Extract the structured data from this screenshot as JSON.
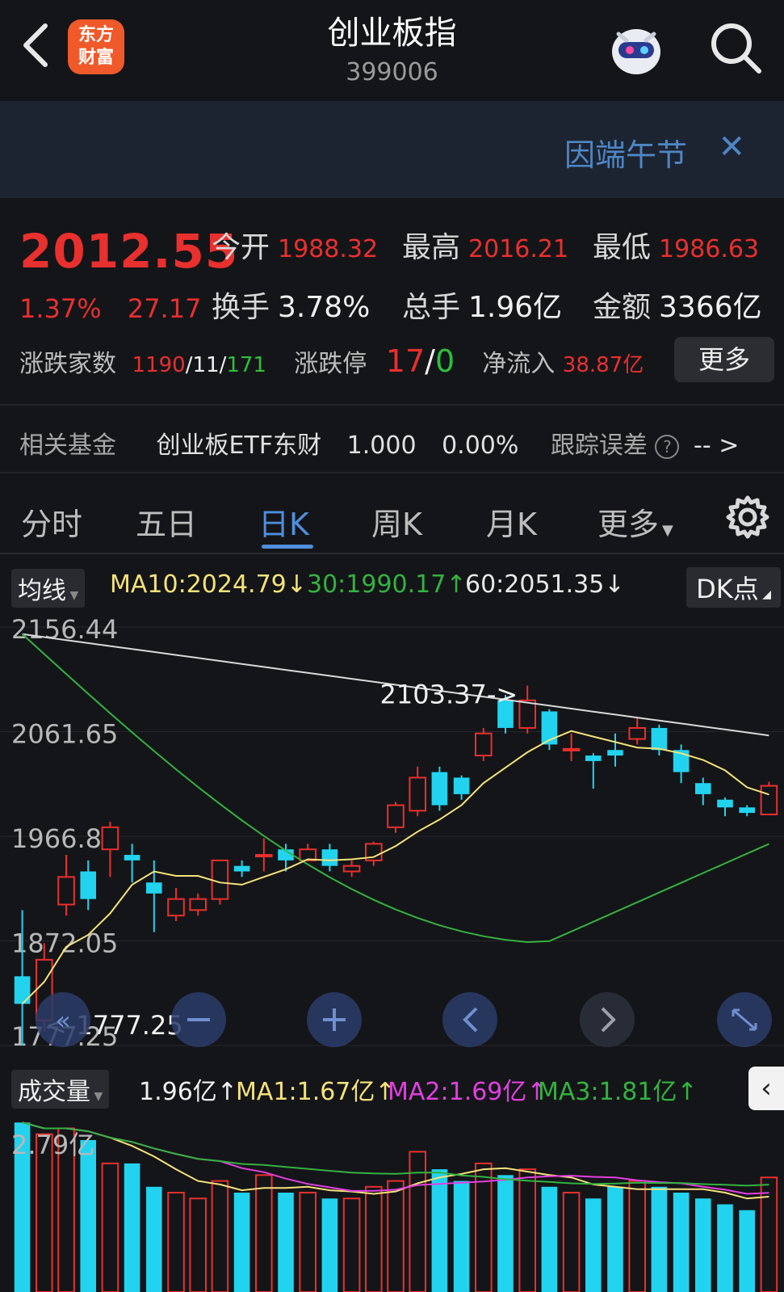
{
  "header": {
    "title": "创业板指",
    "code": "399006",
    "logo_text_line1": "东方",
    "logo_text_line2": "财富"
  },
  "banner": {
    "text": "因端午节"
  },
  "quote": {
    "price": "2012.55",
    "change_pct": "1.37%",
    "change_abs": "27.17",
    "open_label": "今开",
    "open": "1988.32",
    "high_label": "最高",
    "high": "2016.21",
    "low_label": "最低",
    "low": "1986.63",
    "turnover_label": "换手",
    "turnover": "3.78%",
    "volume_label": "总手",
    "volume": "1.96亿",
    "amount_label": "金额",
    "amount": "3366亿",
    "breadth_label": "涨跌家数",
    "up_count": "1190",
    "flat_count": "11",
    "down_count": "171",
    "limit_label": "涨跌停",
    "limit_up": "17",
    "limit_down": "0",
    "netflow_label": "净流入",
    "netflow": "38.87亿",
    "more_label": "更多"
  },
  "fund": {
    "label": "相关基金",
    "name": "创业板ETF东财",
    "nav": "1.000",
    "pct": "0.00%",
    "tracking_label": "跟踪误差",
    "tracking_value": "-- >"
  },
  "tabs": [
    {
      "label": "分时"
    },
    {
      "label": "五日"
    },
    {
      "label": "日K"
    },
    {
      "label": "周K"
    },
    {
      "label": "月K"
    },
    {
      "label": "更多"
    }
  ],
  "ma_legend": {
    "selector": "均线",
    "ma10": "MA10:2024.79↓",
    "ma30": "30:1990.17↑",
    "ma60": "60:2051.35↓",
    "dk": "DK点"
  },
  "vol_legend": {
    "selector": "成交量",
    "vol": "1.96亿↑",
    "ma1": "MA1:1.67亿↑",
    "ma2": "MA2:1.69亿↑",
    "ma3": "MA3:1.81亿↑"
  },
  "colors": {
    "up": "#e8302e",
    "down": "#22d3f0",
    "ma10": "#f5e27a",
    "ma30": "#33b240",
    "ma60": "#d8d8d8",
    "accent": "#4f8fdd"
  },
  "chart_data": {
    "type": "candlestick",
    "y_ticks": [
      "2156.44",
      "2061.65",
      "1966.85",
      "1872.05",
      "1777.25"
    ],
    "ylim": [
      1777.25,
      2156.44
    ],
    "annotations": {
      "high_marker": "2103.37",
      "low_marker": "1777.25"
    },
    "candles": [
      {
        "o": 1840,
        "c": 1815,
        "h": 1900,
        "l": 1777.25
      },
      {
        "o": 1800,
        "c": 1855,
        "h": 1870,
        "l": 1790
      },
      {
        "o": 1905,
        "c": 1930,
        "h": 1950,
        "l": 1895
      },
      {
        "o": 1935,
        "c": 1910,
        "h": 1945,
        "l": 1900
      },
      {
        "o": 1955,
        "c": 1975,
        "h": 1980,
        "l": 1930
      },
      {
        "o": 1950,
        "c": 1945,
        "h": 1960,
        "l": 1925
      },
      {
        "o": 1925,
        "c": 1915,
        "h": 1945,
        "l": 1880
      },
      {
        "o": 1895,
        "c": 1910,
        "h": 1920,
        "l": 1890
      },
      {
        "o": 1900,
        "c": 1910,
        "h": 1915,
        "l": 1895
      },
      {
        "o": 1910,
        "c": 1945,
        "h": 1945,
        "l": 1905
      },
      {
        "o": 1940,
        "c": 1935,
        "h": 1945,
        "l": 1930
      },
      {
        "o": 1950,
        "c": 1950,
        "h": 1965,
        "l": 1935
      },
      {
        "o": 1955,
        "c": 1945,
        "h": 1960,
        "l": 1935
      },
      {
        "o": 1945,
        "c": 1955,
        "h": 1960,
        "l": 1945
      },
      {
        "o": 1955,
        "c": 1940,
        "h": 1960,
        "l": 1935
      },
      {
        "o": 1935,
        "c": 1940,
        "h": 1945,
        "l": 1930
      },
      {
        "o": 1945,
        "c": 1960,
        "h": 1962,
        "l": 1940
      },
      {
        "o": 1975,
        "c": 1995,
        "h": 1998,
        "l": 1970
      },
      {
        "o": 1990,
        "c": 2020,
        "h": 2030,
        "l": 1985
      },
      {
        "o": 2025,
        "c": 1995,
        "h": 2030,
        "l": 1990
      },
      {
        "o": 2020,
        "c": 2005,
        "h": 2022,
        "l": 2000
      },
      {
        "o": 2040,
        "c": 2060,
        "h": 2065,
        "l": 2035
      },
      {
        "o": 2090,
        "c": 2065,
        "h": 2095,
        "l": 2060
      },
      {
        "o": 2065,
        "c": 2090,
        "h": 2103.37,
        "l": 2060
      },
      {
        "o": 2080,
        "c": 2050,
        "h": 2082,
        "l": 2045
      },
      {
        "o": 2045,
        "c": 2046,
        "h": 2060,
        "l": 2035
      },
      {
        "o": 2040,
        "c": 2035,
        "h": 2042,
        "l": 2010
      },
      {
        "o": 2045,
        "c": 2040,
        "h": 2060,
        "l": 2030
      },
      {
        "o": 2055,
        "c": 2065,
        "h": 2075,
        "l": 2050
      },
      {
        "o": 2065,
        "c": 2045,
        "h": 2068,
        "l": 2040
      },
      {
        "o": 2045,
        "c": 2025,
        "h": 2050,
        "l": 2015
      },
      {
        "o": 2015,
        "c": 2005,
        "h": 2020,
        "l": 1995
      },
      {
        "o": 2000,
        "c": 1993,
        "h": 2002,
        "l": 1985
      },
      {
        "o": 1993,
        "c": 1988,
        "h": 1995,
        "l": 1985
      },
      {
        "o": 1986.63,
        "c": 2012.55,
        "h": 2016.21,
        "l": 1986.63
      }
    ],
    "volume_tick": "2.79亿",
    "volumes": [
      2.9,
      2.7,
      2.8,
      2.6,
      2.2,
      2.2,
      1.8,
      1.7,
      1.6,
      1.9,
      1.7,
      2.0,
      1.7,
      1.7,
      1.6,
      1.6,
      1.8,
      1.9,
      2.4,
      2.1,
      1.9,
      2.2,
      2.0,
      2.1,
      1.8,
      1.7,
      1.6,
      1.8,
      1.9,
      1.8,
      1.7,
      1.6,
      1.5,
      1.4,
      1.96
    ]
  }
}
